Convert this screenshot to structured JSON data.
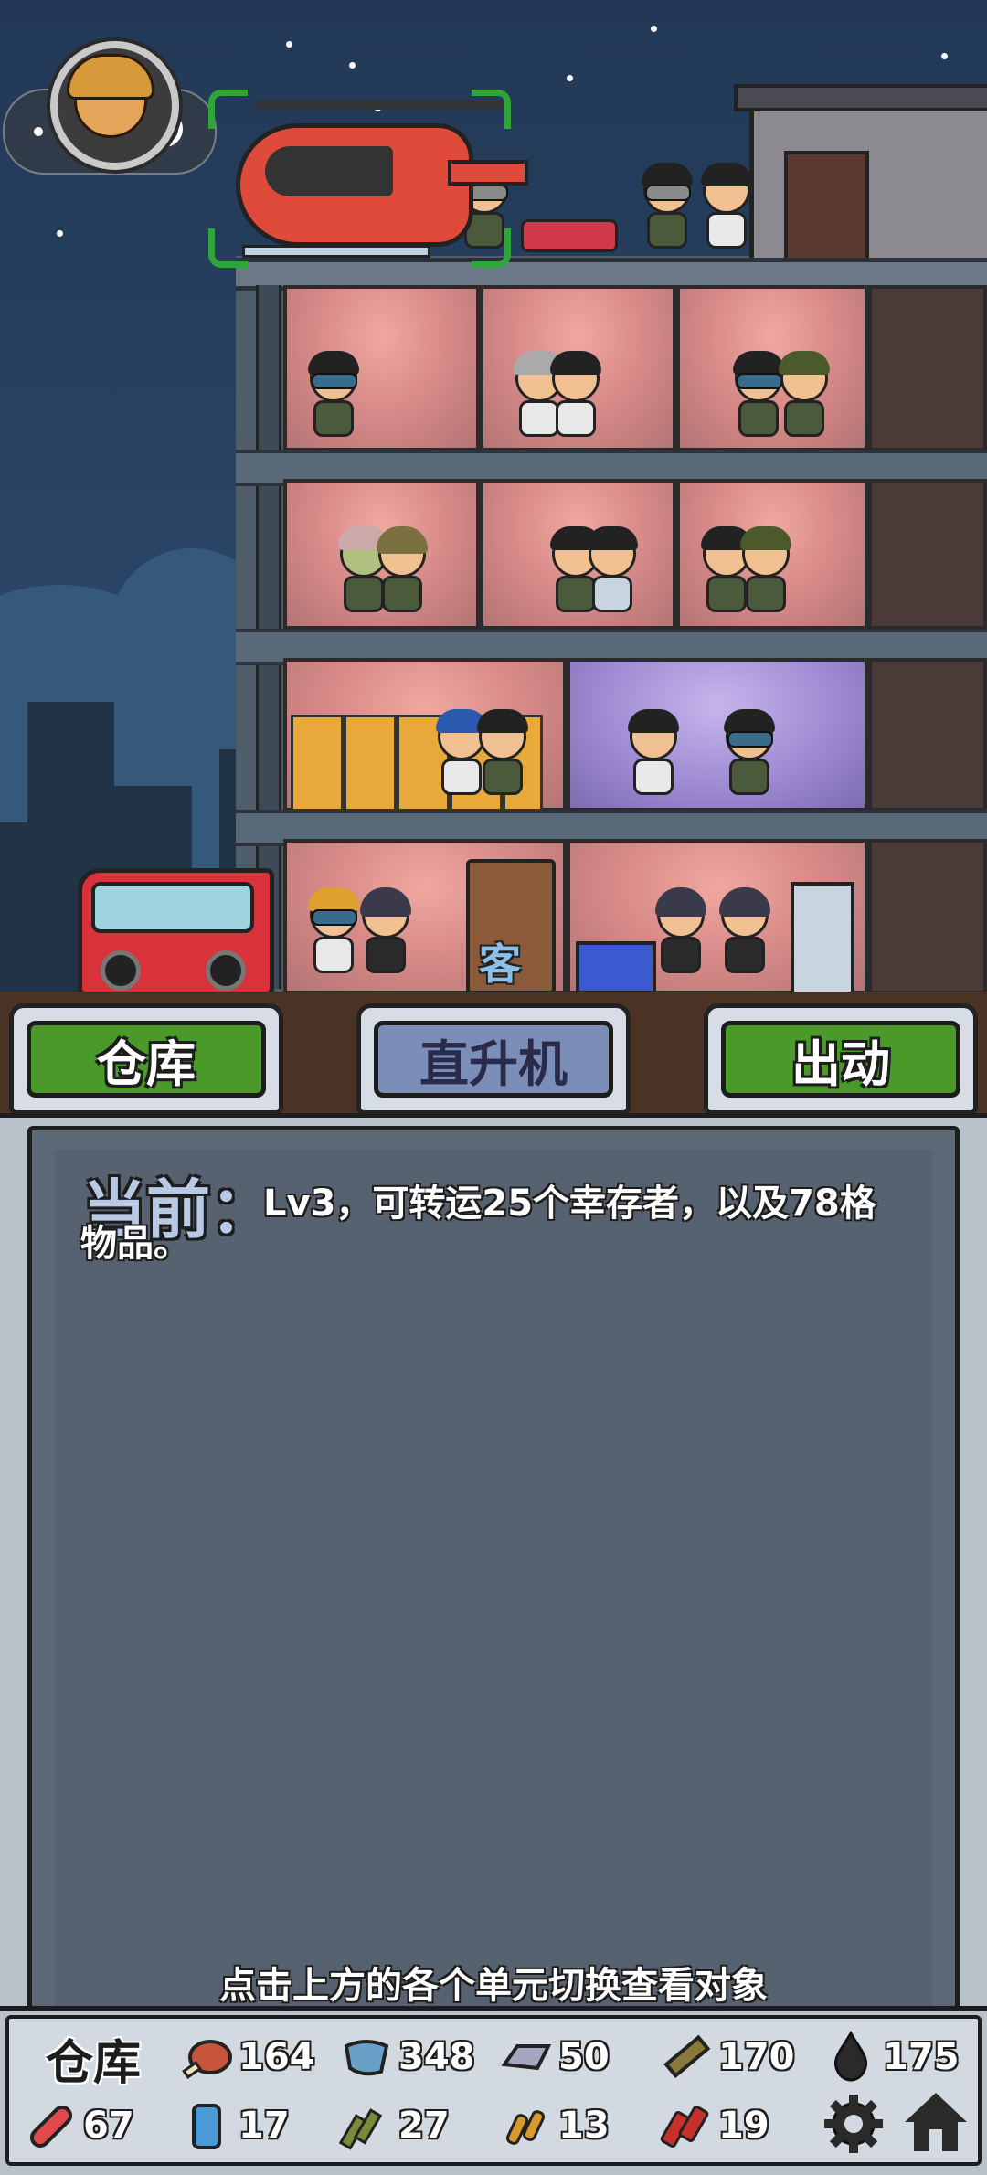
{
  "tabs": {
    "warehouse": "仓库",
    "helicopter": "直升机",
    "dispatch": "出动"
  },
  "room_sign": "客",
  "panel": {
    "current_label": "当前：",
    "current_text": "Lv3，可转运25个幸存者，以及78格物品。",
    "hint": "点击上方的各个单元切换查看对象"
  },
  "resources": {
    "label": "仓库",
    "items": [
      {
        "icon": "meat-icon",
        "value": "164",
        "color": "#c8553a"
      },
      {
        "icon": "cloth-icon",
        "value": "348",
        "color": "#6aa0c8"
      },
      {
        "icon": "metal-ingot-icon",
        "value": "50",
        "color": "#a6a6c0"
      },
      {
        "icon": "wood-plank-icon",
        "value": "170",
        "color": "#8a7a3a"
      },
      {
        "icon": "oil-drop-icon",
        "value": "175",
        "color": "#2a2a2a"
      },
      {
        "icon": "medicine-pill-icon",
        "value": "67",
        "color": "#e0484a"
      },
      {
        "icon": "battery-can-icon",
        "value": "17",
        "color": "#4a9ad8"
      },
      {
        "icon": "rifle-ammo-icon",
        "value": "27",
        "color": "#7a8a3a"
      },
      {
        "icon": "pistol-ammo-icon",
        "value": "13",
        "color": "#d89a2a"
      },
      {
        "icon": "shotgun-shell-icon",
        "value": "19",
        "color": "#c8302a"
      }
    ]
  },
  "colors": {
    "green_tab": "#4a9a2a",
    "blue_tab": "#7a8eb8",
    "panel": "#5b6876"
  }
}
